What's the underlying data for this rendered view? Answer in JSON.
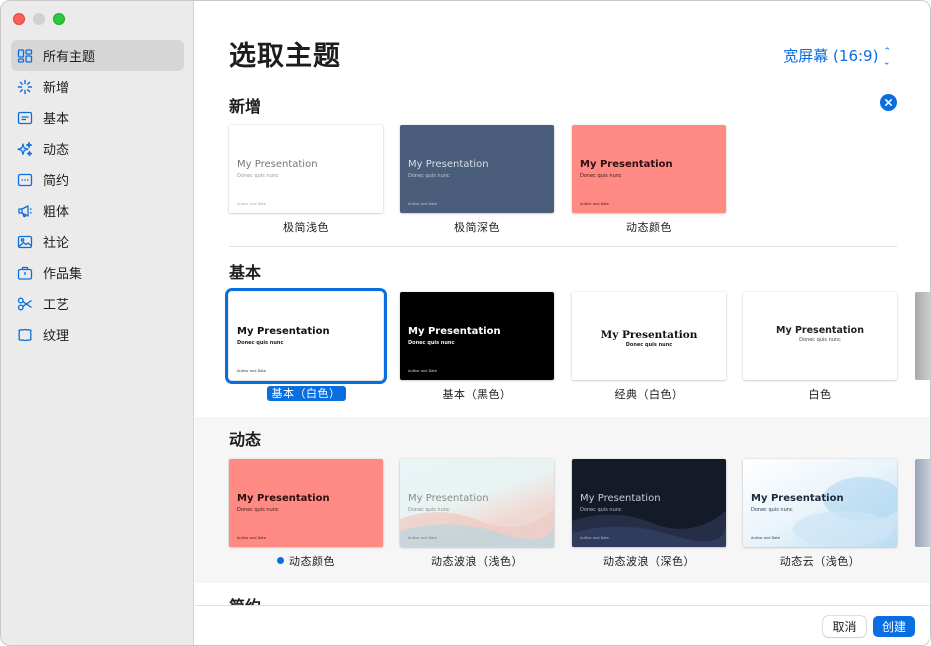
{
  "window": {
    "traffic_lights": [
      "close",
      "minimize",
      "maximize"
    ]
  },
  "sidebar": {
    "items": [
      {
        "label": "所有主题",
        "icon": "grid-icon",
        "selected": true
      },
      {
        "label": "新增",
        "icon": "sparkle-burst-icon",
        "selected": false
      },
      {
        "label": "基本",
        "icon": "slide-basic-icon",
        "selected": false
      },
      {
        "label": "动态",
        "icon": "sparkles-icon",
        "selected": false
      },
      {
        "label": "简约",
        "icon": "slide-minimal-icon",
        "selected": false
      },
      {
        "label": "粗体",
        "icon": "megaphone-icon",
        "selected": false
      },
      {
        "label": "社论",
        "icon": "photo-icon",
        "selected": false
      },
      {
        "label": "作品集",
        "icon": "briefcase-icon",
        "selected": false
      },
      {
        "label": "工艺",
        "icon": "scissors-icon",
        "selected": false
      },
      {
        "label": "纹理",
        "icon": "texture-frame-icon",
        "selected": false
      }
    ]
  },
  "header": {
    "title": "选取主题",
    "aspect_ratio": "宽屏幕 (16:9)"
  },
  "sections": {
    "new": {
      "title": "新增",
      "themes": [
        {
          "label": "极简浅色",
          "slide_title": "My Presentation",
          "slide_subtitle": "Donec quis nunc",
          "slide_footer": "Author and Date"
        },
        {
          "label": "极简深色",
          "slide_title": "My Presentation",
          "slide_subtitle": "Donec quis nunc",
          "slide_footer": "Author and Date"
        },
        {
          "label": "动态颜色",
          "slide_title": "My Presentation",
          "slide_subtitle": "Donec quis nunc",
          "slide_footer": "Author and Date"
        }
      ]
    },
    "basic": {
      "title": "基本",
      "themes": [
        {
          "label": "基本（白色）",
          "selected": true,
          "slide_title": "My Presentation",
          "slide_subtitle": "Donec quis nunc",
          "slide_footer": "Author and Date"
        },
        {
          "label": "基本（黑色）",
          "slide_title": "My Presentation",
          "slide_subtitle": "Donec quis nunc",
          "slide_footer": "Author and Date"
        },
        {
          "label": "经典（白色）",
          "slide_title": "My Presentation",
          "slide_subtitle": "Donec quis nunc"
        },
        {
          "label": "白色",
          "slide_title": "My Presentation",
          "slide_subtitle": "Donec quis nunc"
        }
      ]
    },
    "dynamic": {
      "title": "动态",
      "themes": [
        {
          "label": "动态颜色",
          "marked": true,
          "slide_title": "My Presentation",
          "slide_subtitle": "Donec quis nunc",
          "slide_footer": "Author and Date"
        },
        {
          "label": "动态波浪（浅色）",
          "slide_title": "My Presentation",
          "slide_subtitle": "Donec quis nunc",
          "slide_footer": "Author and Date"
        },
        {
          "label": "动态波浪（深色）",
          "slide_title": "My Presentation",
          "slide_subtitle": "Donec quis nunc",
          "slide_footer": "Author and Date"
        },
        {
          "label": "动态云（浅色）",
          "slide_title": "My Presentation",
          "slide_subtitle": "Donec quis nunc",
          "slide_footer": "Author and Date"
        }
      ]
    },
    "minimal": {
      "title": "简约"
    }
  },
  "footer": {
    "cancel_label": "取消",
    "create_label": "创建"
  },
  "colors": {
    "accent": "#0a6ee0",
    "coral": "#ff8a84",
    "slate": "#4a5d7a"
  }
}
